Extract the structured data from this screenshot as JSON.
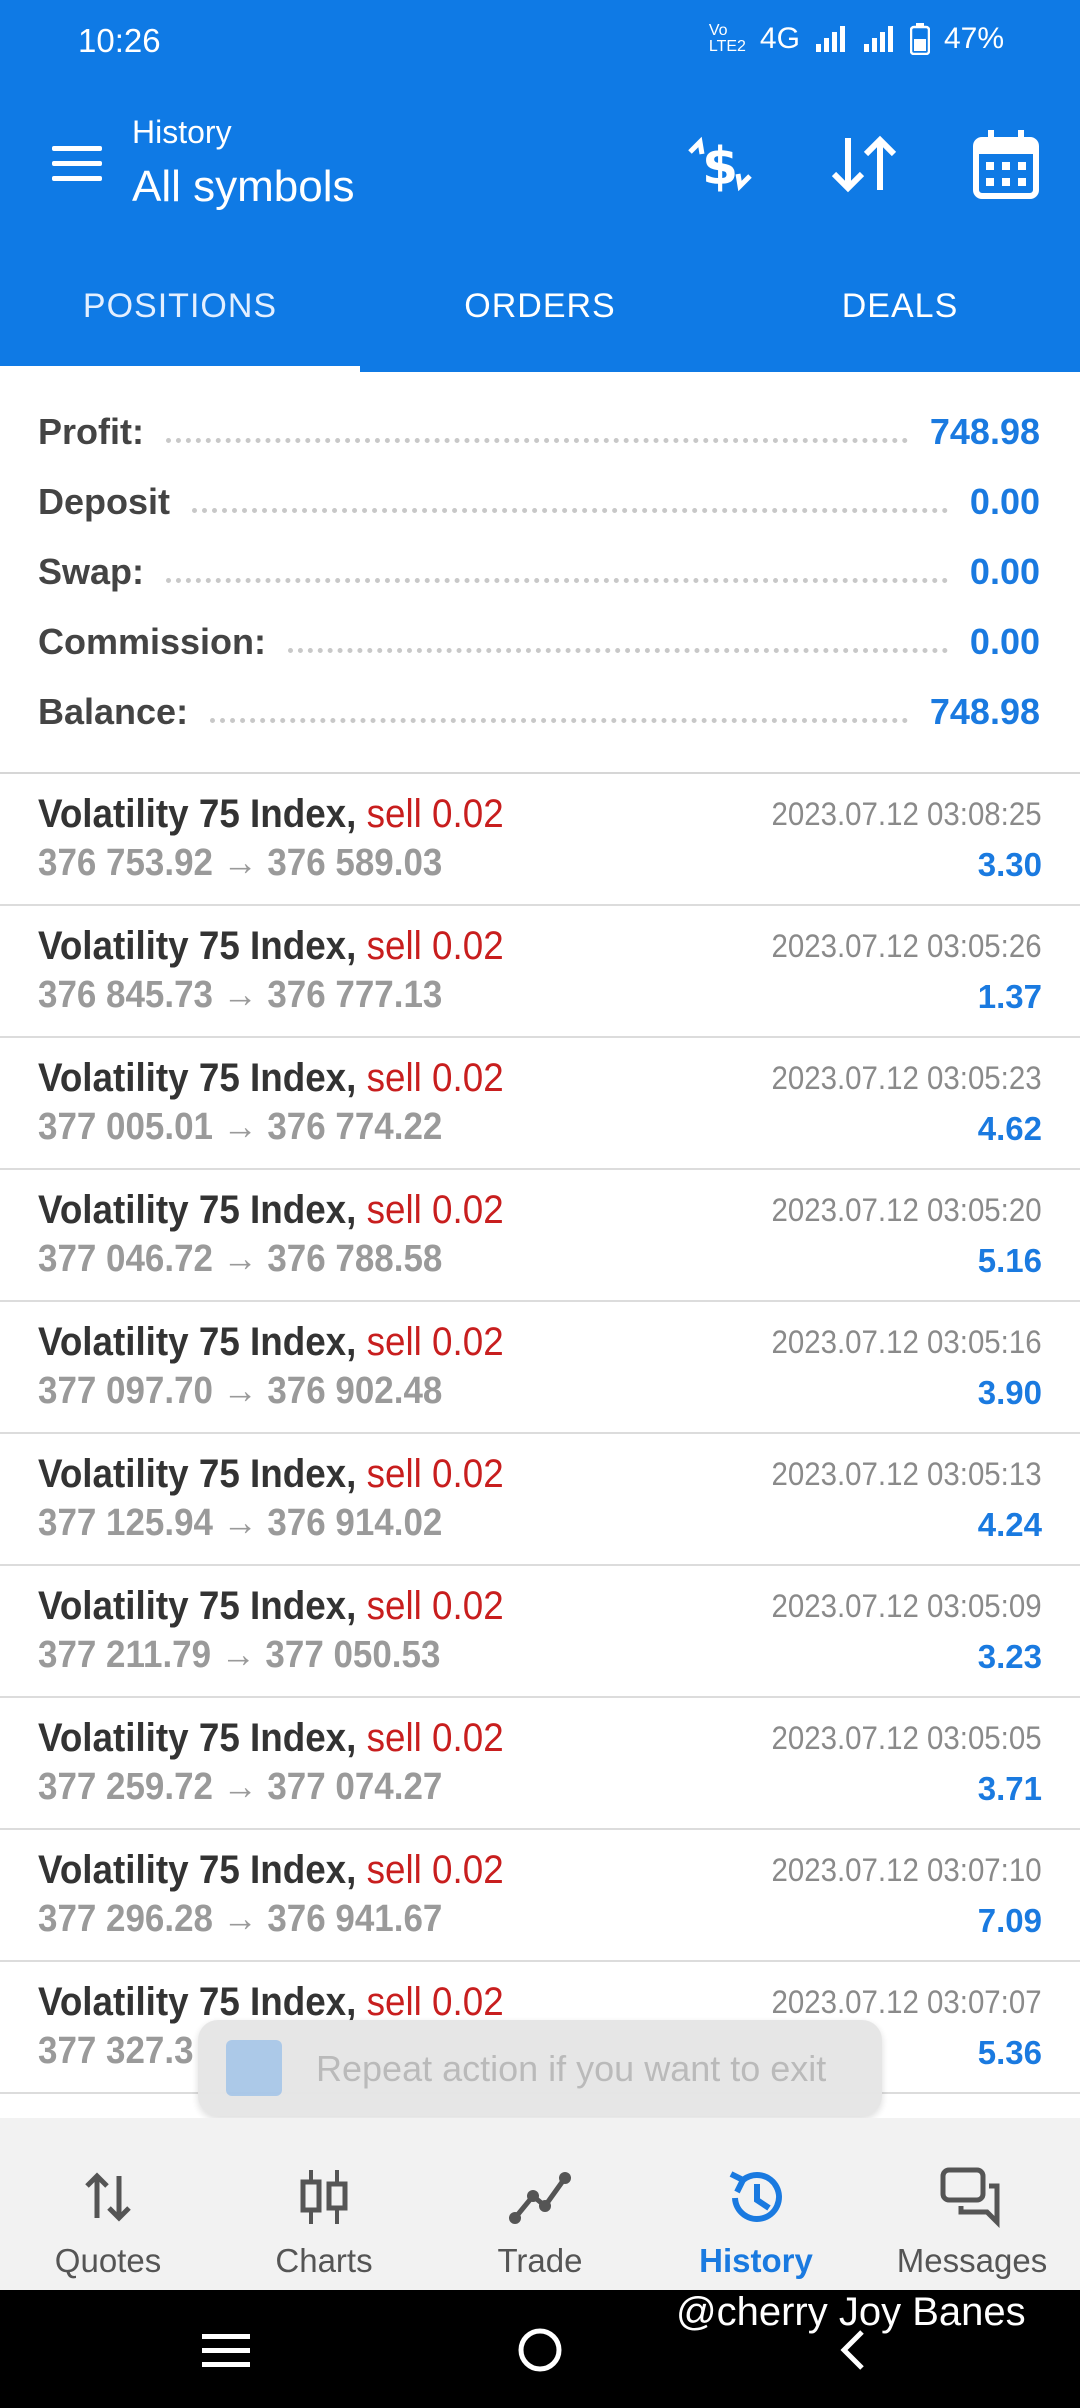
{
  "status": {
    "time": "10:26",
    "network": "4G",
    "battery": "47%"
  },
  "header": {
    "subtitle": "History",
    "title": "All symbols",
    "icons": [
      "menu-icon",
      "currency-exchange-icon",
      "sort-icon",
      "calendar-icon"
    ]
  },
  "tabs": [
    "POSITIONS",
    "ORDERS",
    "DEALS"
  ],
  "summary": [
    {
      "label": "Profit:",
      "value": "748.98"
    },
    {
      "label": "Deposit",
      "value": "0.00"
    },
    {
      "label": "Swap:",
      "value": "0.00"
    },
    {
      "label": "Commission:",
      "value": "0.00"
    },
    {
      "label": "Balance:",
      "value": "748.98"
    }
  ],
  "positions": [
    {
      "symbol": "Volatility 75 Index,",
      "side": "sell 0.02",
      "prices": "376 753.92 → 376 589.03",
      "time": "2023.07.12 03:08:25",
      "profit": "3.30"
    },
    {
      "symbol": "Volatility 75 Index,",
      "side": "sell 0.02",
      "prices": "376 845.73 → 376 777.13",
      "time": "2023.07.12 03:05:26",
      "profit": "1.37"
    },
    {
      "symbol": "Volatility 75 Index,",
      "side": "sell 0.02",
      "prices": "377 005.01 → 376 774.22",
      "time": "2023.07.12 03:05:23",
      "profit": "4.62"
    },
    {
      "symbol": "Volatility 75 Index,",
      "side": "sell 0.02",
      "prices": "377 046.72 → 376 788.58",
      "time": "2023.07.12 03:05:20",
      "profit": "5.16"
    },
    {
      "symbol": "Volatility 75 Index,",
      "side": "sell 0.02",
      "prices": "377 097.70 → 376 902.48",
      "time": "2023.07.12 03:05:16",
      "profit": "3.90"
    },
    {
      "symbol": "Volatility 75 Index,",
      "side": "sell 0.02",
      "prices": "377 125.94 → 376 914.02",
      "time": "2023.07.12 03:05:13",
      "profit": "4.24"
    },
    {
      "symbol": "Volatility 75 Index,",
      "side": "sell 0.02",
      "prices": "377 211.79 → 377 050.53",
      "time": "2023.07.12 03:05:09",
      "profit": "3.23"
    },
    {
      "symbol": "Volatility 75 Index,",
      "side": "sell 0.02",
      "prices": "377 259.72 → 377 074.27",
      "time": "2023.07.12 03:05:05",
      "profit": "3.71"
    },
    {
      "symbol": "Volatility 75 Index,",
      "side": "sell 0.02",
      "prices": "377 296.28 → 376 941.67",
      "time": "2023.07.12 03:07:10",
      "profit": "7.09"
    },
    {
      "symbol": "Volatility 75 Index,",
      "side": "sell 0.02",
      "prices": "377 327.3",
      "time": "2023.07.12 03:07:07",
      "profit": "5.36"
    }
  ],
  "toast": "Repeat action if you want to exit",
  "nav": [
    "Quotes",
    "Charts",
    "Trade",
    "History",
    "Messages"
  ],
  "watermark": "@cherry Joy Banes",
  "colors": {
    "primary": "#0f7ae5",
    "sell": "#c81e1e",
    "profit": "#1a7ae0"
  }
}
